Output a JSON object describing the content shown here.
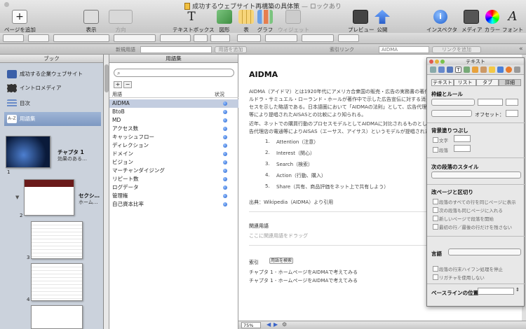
{
  "window": {
    "title": "成功するウェブサイト再構築の具体策",
    "locked": "— ロックあり"
  },
  "toolbar": {
    "add_page": "ページを追加",
    "view": "表示",
    "orientation": "方向",
    "textbox": "テキストボックス",
    "shapes": "図形",
    "table": "表",
    "chart": "グラフ",
    "widget": "ウィジェット",
    "preview": "プレビュー",
    "publish": "公開",
    "inspector": "インスペクタ",
    "media": "メディア",
    "colors": "カラー",
    "fonts": "フォント"
  },
  "bar2": {
    "new_term": "新規用語",
    "add_term": "用語を追加",
    "index_link": "索引リンク",
    "index_value": "AIDMA",
    "add_link": "リンクを追加"
  },
  "book": {
    "header": "ブック",
    "items": [
      {
        "label": "成功する企業ウェブサイト"
      },
      {
        "label": "イントロメディア"
      },
      {
        "label": "目次"
      },
      {
        "label": "用語集"
      }
    ],
    "chapter1": {
      "number": "1",
      "title": "チャプタ 1",
      "subtitle": "効果のある…"
    },
    "section": {
      "title": "セクシ…",
      "subtitle": "ホーム…"
    },
    "page_numbers": [
      "2",
      "3",
      "4"
    ]
  },
  "glossary": {
    "header": "用語集",
    "col_term": "用語",
    "col_status": "状況",
    "add": "+",
    "remove": "−",
    "terms": [
      "AIDMA",
      "BtoB",
      "MD",
      "アクセス数",
      "キャッシュフロー",
      "ディレクション",
      "ドメイン",
      "ビジョン",
      "マーチャンダイジング",
      "リピート数",
      "ログデータ",
      "管理権",
      "自己資本比率"
    ]
  },
  "doc": {
    "title": "AIDMA",
    "p1": [
      "AIDMA（アイドマ）とは1920年代にアメリカ合衆国の販売・広告の実務書の著作",
      "ルドラ・サミュエル・ローランド・ホールが著作中で示した広告宣伝に対する消費者の心",
      "セスを示した略語である。日本語圏において「AIDMAの法則」として、広告代理店",
      "等により提唱されたAISASとの比較により知られる。"
    ],
    "p2": [
      "近年、ネットでの購買行動のプロセスモデルとしてAIDMAに対比されるものとして",
      "告代理店の電通等によりAISAS（エーサス、アイサス）というモデルが提唱された"
    ],
    "list": [
      {
        "n": "1.",
        "t": "Attention（注意）"
      },
      {
        "n": "2.",
        "t": "Interest（関心）"
      },
      {
        "n": "3.",
        "t": "Search（検索）"
      },
      {
        "n": "4.",
        "t": "Action（行動、購入）"
      },
      {
        "n": "5.",
        "t": "Share（共有、商品評価をネット上で共有しよう）"
      }
    ],
    "source": "出典：Wikipedia（AIDMA）より引用",
    "related_heading": "関連用語",
    "related_placeholder": "ここに関連用語をドラッグ",
    "index_heading": "索引",
    "index_button": "用語を検索",
    "index_entries": [
      "チャプタ 1 - ホームページをAIDMAで考えてみる",
      "チャプタ 1 - ホームページをAIDMAで考えてみる"
    ]
  },
  "bottombar": {
    "zoom": "75%"
  },
  "inspector": {
    "title": "テキスト",
    "tabs": [
      "テキスト",
      "リスト",
      "タブ",
      "詳細"
    ],
    "borders_heading": "枠線とルール",
    "offset_label": "オフセット：",
    "bg_heading": "背景塗りつぶし",
    "bg_char": "文字",
    "bg_para": "段落",
    "next_style_heading": "次の段落のスタイル",
    "break_heading": "改ページと区切り",
    "break_opts": [
      "段落のすべての行を同じページに表示",
      "次の段落も同じページに入れる",
      "新しいページで段落を開始",
      "最初の行／最後の行だけを残さない"
    ],
    "language_heading": "言語",
    "lang_opts": [
      "段落の行末ハイフン処理を停止",
      "リガチャを使用しない"
    ],
    "baseline_heading": "ベースラインの位置"
  }
}
